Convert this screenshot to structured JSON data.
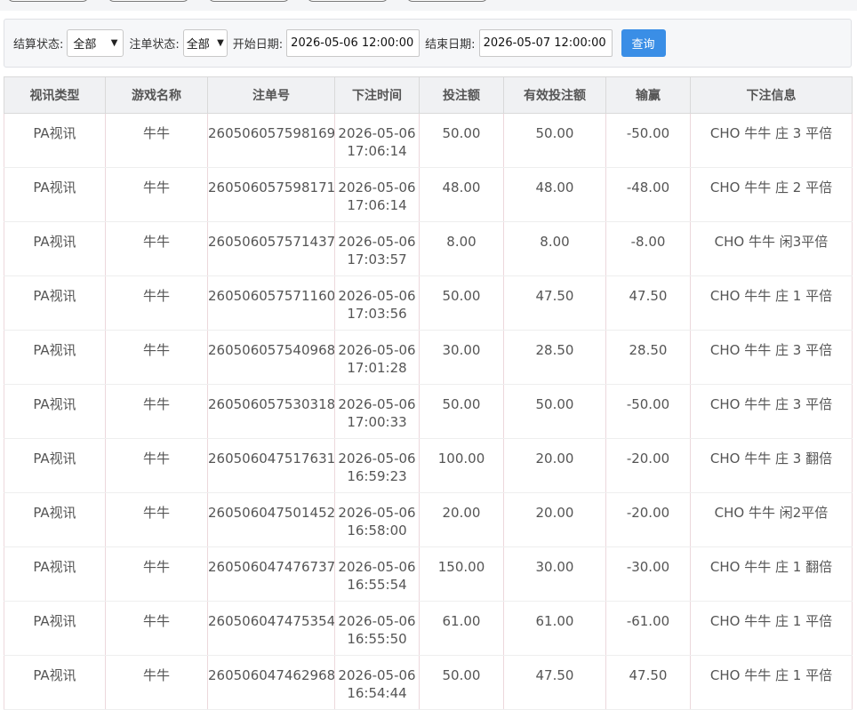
{
  "filters": {
    "settle_label": "结算状态:",
    "settle_value": "全部",
    "order_label": "注单状态:",
    "order_value": "全部",
    "start_label": "开始日期:",
    "start_value": "2026-05-06 12:00:00",
    "end_label": "结束日期:",
    "end_value": "2026-05-07 12:00:00",
    "query_label": "查询"
  },
  "table": {
    "headers": [
      "视讯类型",
      "游戏名称",
      "注单号",
      "下注时间",
      "投注额",
      "有效投注额",
      "输赢",
      "下注信息"
    ],
    "rows": [
      {
        "type": "PA视讯",
        "game": "牛牛",
        "order": "260506057598169",
        "date": "2026-05-06",
        "time": "17:06:14",
        "bet": "50.00",
        "valid": "50.00",
        "win": "-50.00",
        "info": "CHO 牛牛 庄 3 平倍"
      },
      {
        "type": "PA视讯",
        "game": "牛牛",
        "order": "260506057598171",
        "date": "2026-05-06",
        "time": "17:06:14",
        "bet": "48.00",
        "valid": "48.00",
        "win": "-48.00",
        "info": "CHO 牛牛 庄 2 平倍"
      },
      {
        "type": "PA视讯",
        "game": "牛牛",
        "order": "260506057571437",
        "date": "2026-05-06",
        "time": "17:03:57",
        "bet": "8.00",
        "valid": "8.00",
        "win": "-8.00",
        "info": "CHO 牛牛 闲3平倍"
      },
      {
        "type": "PA视讯",
        "game": "牛牛",
        "order": "260506057571160",
        "date": "2026-05-06",
        "time": "17:03:56",
        "bet": "50.00",
        "valid": "47.50",
        "win": "47.50",
        "info": "CHO 牛牛 庄 1 平倍"
      },
      {
        "type": "PA视讯",
        "game": "牛牛",
        "order": "260506057540968",
        "date": "2026-05-06",
        "time": "17:01:28",
        "bet": "30.00",
        "valid": "28.50",
        "win": "28.50",
        "info": "CHO 牛牛 庄 3 平倍"
      },
      {
        "type": "PA视讯",
        "game": "牛牛",
        "order": "260506057530318",
        "date": "2026-05-06",
        "time": "17:00:33",
        "bet": "50.00",
        "valid": "50.00",
        "win": "-50.00",
        "info": "CHO 牛牛 庄 3 平倍"
      },
      {
        "type": "PA视讯",
        "game": "牛牛",
        "order": "260506047517631",
        "date": "2026-05-06",
        "time": "16:59:23",
        "bet": "100.00",
        "valid": "20.00",
        "win": "-20.00",
        "info": "CHO 牛牛 庄 3 翻倍"
      },
      {
        "type": "PA视讯",
        "game": "牛牛",
        "order": "260506047501452",
        "date": "2026-05-06",
        "time": "16:58:00",
        "bet": "20.00",
        "valid": "20.00",
        "win": "-20.00",
        "info": "CHO 牛牛 闲2平倍"
      },
      {
        "type": "PA视讯",
        "game": "牛牛",
        "order": "260506047476737",
        "date": "2026-05-06",
        "time": "16:55:54",
        "bet": "150.00",
        "valid": "30.00",
        "win": "-30.00",
        "info": "CHO 牛牛 庄 1 翻倍"
      },
      {
        "type": "PA视讯",
        "game": "牛牛",
        "order": "260506047475354",
        "date": "2026-05-06",
        "time": "16:55:50",
        "bet": "61.00",
        "valid": "61.00",
        "win": "-61.00",
        "info": "CHO 牛牛 庄 1 平倍"
      },
      {
        "type": "PA视讯",
        "game": "牛牛",
        "order": "260506047462968",
        "date": "2026-05-06",
        "time": "16:54:44",
        "bet": "50.00",
        "valid": "47.50",
        "win": "47.50",
        "info": "CHO 牛牛 庄 1 平倍"
      }
    ]
  }
}
